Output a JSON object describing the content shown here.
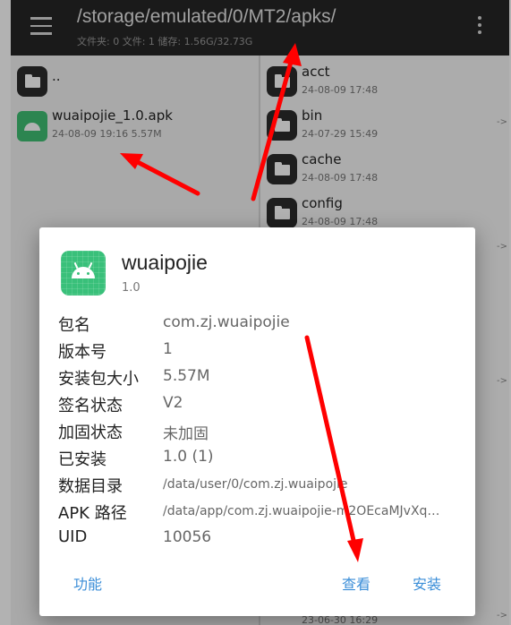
{
  "topbar": {
    "path": "/storage/emulated/0/MT2/apks/",
    "stats": "文件夹: 0  文件: 1  储存: 1.56G/32.73G"
  },
  "left_pane": {
    "items": [
      {
        "name": "..",
        "meta": "",
        "icon": "folder-icon"
      },
      {
        "name": "wuaipojie_1.0.apk",
        "meta": "24-08-09 19:16  5.57M",
        "icon": "android-icon"
      }
    ]
  },
  "right_pane": {
    "items": [
      {
        "name": "acct",
        "meta": "24-08-09 17:48",
        "hint": ""
      },
      {
        "name": "bin",
        "meta": "24-07-29 15:49",
        "hint": "->"
      },
      {
        "name": "cache",
        "meta": "24-08-09 17:48",
        "hint": ""
      },
      {
        "name": "config",
        "meta": "24-08-09 17:48",
        "hint": ""
      }
    ],
    "side_hints": [
      "->",
      "->",
      "->"
    ],
    "bottom_meta": "23-06-30 16:29"
  },
  "dialog": {
    "app_name": "wuaipojie",
    "version_name": "1.0",
    "rows": [
      {
        "label": "包名",
        "value": "com.zj.wuaipojie"
      },
      {
        "label": "版本号",
        "value": "1"
      },
      {
        "label": "安装包大小",
        "value": "5.57M"
      },
      {
        "label": "签名状态",
        "value": "V2"
      },
      {
        "label": "加固状态",
        "value": "未加固"
      },
      {
        "label": "已安装",
        "value": "1.0 (1)"
      },
      {
        "label": "数据目录",
        "value": "/data/user/0/com.zj.wuaipojie"
      },
      {
        "label": "APK 路径",
        "value": "/data/app/com.zj.wuaipojie-m2OEcaMJvXq…"
      },
      {
        "label": "UID",
        "value": "10056"
      }
    ],
    "buttons": {
      "function": "功能",
      "view": "查看",
      "install": "安装"
    }
  },
  "colors": {
    "topbar": "#262626",
    "accent": "#3b8ed8",
    "annotation_arrow": "#ff0000",
    "apk_icon": "#39c07a"
  }
}
